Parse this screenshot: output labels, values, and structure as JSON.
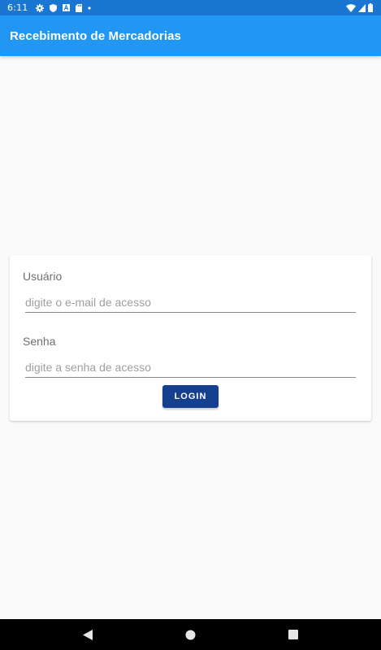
{
  "status_bar": {
    "time": "6:11",
    "left_icons": [
      "settings-icon",
      "shield-icon",
      "font-icon",
      "sd-card-icon",
      "dot-icon"
    ],
    "right_icons": [
      "wifi-icon",
      "cell-signal-icon",
      "battery-icon"
    ]
  },
  "app_bar": {
    "title": "Recebimento de Mercadorias",
    "color": "#2196f3"
  },
  "login_form": {
    "username": {
      "label": "Usuário",
      "placeholder": "digite o e-mail de acesso",
      "value": ""
    },
    "password": {
      "label": "Senha",
      "placeholder": "digite a senha de acesso",
      "value": ""
    },
    "login_button_label": "LOGIN",
    "login_button_color": "#173f8f"
  },
  "nav_bar": {
    "buttons": [
      "back-icon",
      "home-icon",
      "recents-icon"
    ]
  }
}
